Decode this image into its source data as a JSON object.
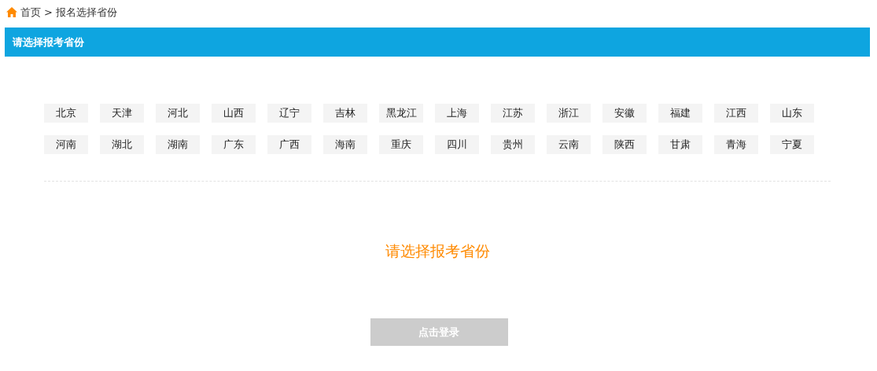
{
  "breadcrumb": {
    "items": [
      "首页",
      "报名选择省份"
    ],
    "separator": ">"
  },
  "header": {
    "title": "请选择报考省份"
  },
  "provinces": [
    {
      "label": "北京",
      "selected": false
    },
    {
      "label": "天津",
      "selected": false
    },
    {
      "label": "河北",
      "selected": false
    },
    {
      "label": "山西",
      "selected": false
    },
    {
      "label": "辽宁",
      "selected": false
    },
    {
      "label": "吉林",
      "selected": false
    },
    {
      "label": "黑龙江",
      "selected": false
    },
    {
      "label": "上海",
      "selected": false
    },
    {
      "label": "江苏",
      "selected": false
    },
    {
      "label": "浙江",
      "selected": false
    },
    {
      "label": "安徽",
      "selected": false
    },
    {
      "label": "福建",
      "selected": false
    },
    {
      "label": "江西",
      "selected": false
    },
    {
      "label": "山东",
      "selected": false
    },
    {
      "label": "河南",
      "selected": false
    },
    {
      "label": "湖北",
      "selected": false
    },
    {
      "label": "湖南",
      "selected": false
    },
    {
      "label": "广东",
      "selected": false
    },
    {
      "label": "广西",
      "selected": false
    },
    {
      "label": "海南",
      "selected": false
    },
    {
      "label": "重庆",
      "selected": false
    },
    {
      "label": "四川",
      "selected": false
    },
    {
      "label": "贵州",
      "selected": false
    },
    {
      "label": "云南",
      "selected": false
    },
    {
      "label": "陕西",
      "selected": false
    },
    {
      "label": "甘肃",
      "selected": false
    },
    {
      "label": "青海",
      "selected": false
    },
    {
      "label": "宁夏",
      "selected": false
    }
  ],
  "message": "请选择报考省份",
  "login_button": {
    "label": "点击登录",
    "disabled": true
  }
}
